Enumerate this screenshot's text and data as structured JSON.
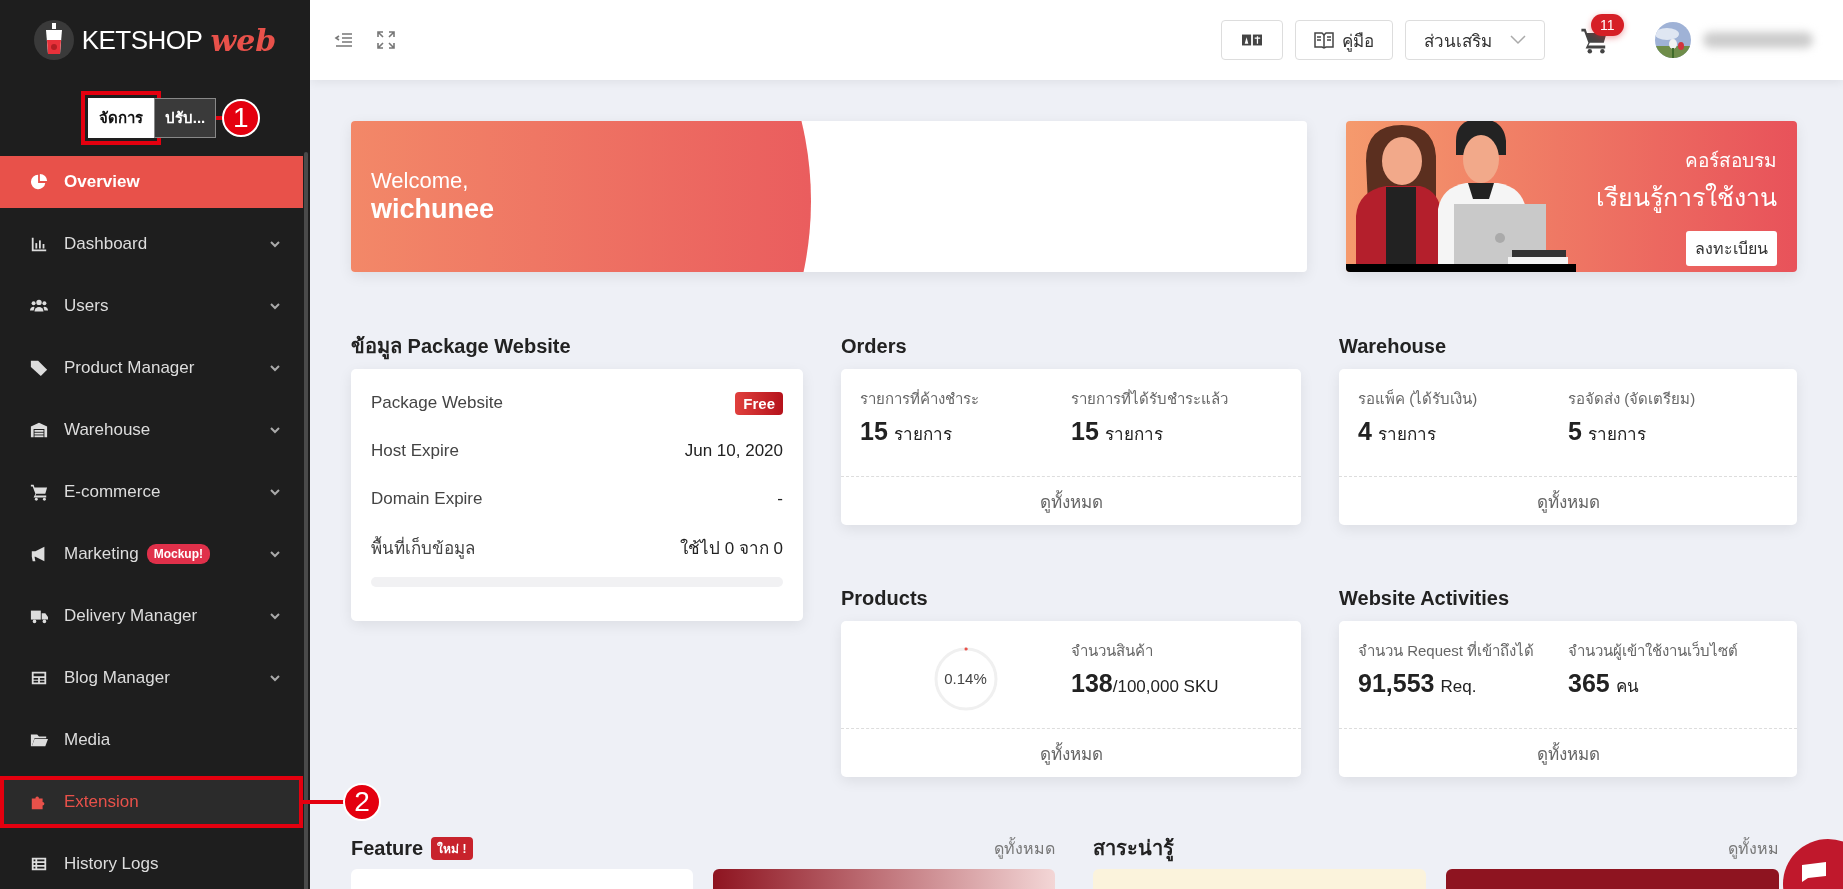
{
  "sidebar": {
    "logo": {
      "brand": "KETSHOP",
      "accent": "web"
    },
    "mode_buttons": [
      {
        "label": "จัดการ",
        "selected": true,
        "callout": "1"
      },
      {
        "label": "ปรับ...",
        "selected": false
      }
    ],
    "items": [
      {
        "label": "Overview",
        "selected": true,
        "expandable": false,
        "highlighted": false
      },
      {
        "label": "Dashboard",
        "selected": false,
        "expandable": true,
        "highlighted": false
      },
      {
        "label": "Users",
        "selected": false,
        "expandable": true,
        "highlighted": false
      },
      {
        "label": "Product Manager",
        "selected": false,
        "expandable": true,
        "highlighted": false
      },
      {
        "label": "Warehouse",
        "selected": false,
        "expandable": true,
        "highlighted": false
      },
      {
        "label": "E-commerce",
        "selected": false,
        "expandable": true,
        "highlighted": false
      },
      {
        "label": "Marketing",
        "badge": "Mockup!",
        "selected": false,
        "expandable": true,
        "highlighted": false
      },
      {
        "label": "Delivery Manager",
        "selected": false,
        "expandable": true,
        "highlighted": false
      },
      {
        "label": "Blog Manager",
        "selected": false,
        "expandable": true,
        "highlighted": false
      },
      {
        "label": "Media",
        "selected": false,
        "expandable": false,
        "highlighted": false
      },
      {
        "label": "Extension",
        "selected": false,
        "expandable": false,
        "highlighted": true,
        "callout": "2"
      },
      {
        "label": "History Logs",
        "selected": false,
        "expandable": false,
        "highlighted": false
      }
    ]
  },
  "topbar": {
    "buttons": [
      {
        "kind": "icon"
      },
      {
        "kind": "labeled",
        "label": "คู่มือ"
      },
      {
        "kind": "dropdown",
        "label": "ส่วนเสริม"
      }
    ],
    "cart_count": "11"
  },
  "welcome": {
    "greeting": "Welcome,",
    "name": "wichunee"
  },
  "course_banner": {
    "subtitle": "คอร์สอบรม",
    "title": "เรียนรู้การใช้งาน",
    "button": "ลงทะเบียน"
  },
  "package": {
    "title": "ข้อมูล Package Website",
    "rows": [
      {
        "label": "Package Website",
        "kind": "badge",
        "value": "Free"
      },
      {
        "label": "Host Expire",
        "kind": "text",
        "value": "Jun 10, 2020"
      },
      {
        "label": "Domain Expire",
        "kind": "text",
        "value": "-"
      },
      {
        "label": "พื้นที่เก็บข้อมูล",
        "kind": "text",
        "value": "ใช้ไป 0 จาก 0"
      }
    ],
    "storage": {
      "level": 0
    }
  },
  "orders": {
    "title": "Orders",
    "stats": [
      {
        "label": "รายการที่ค้างชำระ",
        "number": "15",
        "unit": "รายการ"
      },
      {
        "label": "รายการที่ได้รับชำระแล้ว",
        "number": "15",
        "unit": "รายการ"
      }
    ],
    "footer": "ดูทั้งหมด"
  },
  "warehouse": {
    "title": "Warehouse",
    "stats": [
      {
        "label": "รอแพ็ค (ได้รับเงิน)",
        "number": "4",
        "unit": "รายการ"
      },
      {
        "label": "รอจัดส่ง (จัดเตรียม)",
        "number": "5",
        "unit": "รายการ"
      }
    ],
    "footer": "ดูทั้งหมด"
  },
  "products": {
    "title": "Products",
    "ring": {
      "level": 0.0014,
      "text": "0.14%"
    },
    "stats": [
      {
        "label": "จำนวนสินค้า",
        "number": "138",
        "unit": "/100,000 SKU"
      }
    ],
    "footer": "ดูทั้งหมด"
  },
  "website_activities": {
    "title": "Website Activities",
    "stats": [
      {
        "label": "จำนวน Request ที่เข้าถึงได้",
        "number": "91,553",
        "unit": "Req."
      },
      {
        "label": "จำนวนผู้เข้าใช้งานเว็บไซต์",
        "number": "365",
        "unit": "คน"
      }
    ],
    "footer": "ดูทั้งหมด"
  },
  "feature": {
    "title": "Feature",
    "badge": "ใหม่ !",
    "link": "ดูทั้งหมด"
  },
  "articles": {
    "title": "สาระน่ารู้",
    "link": "ดูทั้งหม"
  }
}
